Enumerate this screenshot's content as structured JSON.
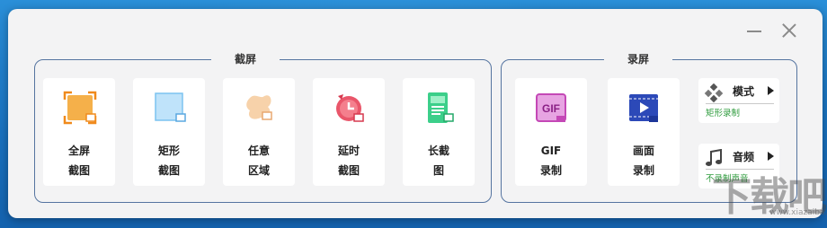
{
  "window": {
    "minimize_icon": "minimize-icon",
    "close_icon": "close-icon"
  },
  "screenshot_group": {
    "title": "截屏",
    "tools": [
      {
        "line1": "全屏",
        "line2": "截图",
        "icon": "fullscreen-capture-icon",
        "color": "#f3a53c"
      },
      {
        "line1": "矩形",
        "line2": "截图",
        "icon": "rectangle-capture-icon",
        "color": "#7cc3f0"
      },
      {
        "line1": "任意",
        "line2": "区域",
        "icon": "freeform-capture-icon",
        "color": "#f3c79a"
      },
      {
        "line1": "延时",
        "line2": "截图",
        "icon": "delayed-capture-icon",
        "color": "#e44a5c"
      },
      {
        "line1": "长截",
        "line2": "图",
        "icon": "long-capture-icon",
        "color": "#2fbf7a"
      }
    ]
  },
  "record_group": {
    "title": "录屏",
    "tools": [
      {
        "line1": "GIF",
        "line2": "录制",
        "icon": "gif-record-icon",
        "color": "#d04fc4"
      },
      {
        "line1": "画面",
        "line2": "录制",
        "icon": "screen-record-icon",
        "color": "#3556c9"
      }
    ],
    "mode": {
      "label": "模式",
      "sub": "矩形录制",
      "icon": "mode-diamond-icon"
    },
    "audio": {
      "label": "音频",
      "sub": "不录制声音",
      "icon": "music-note-icon"
    }
  },
  "watermark": {
    "text": "下载吧",
    "sub": "www.xiazaiba.com"
  }
}
